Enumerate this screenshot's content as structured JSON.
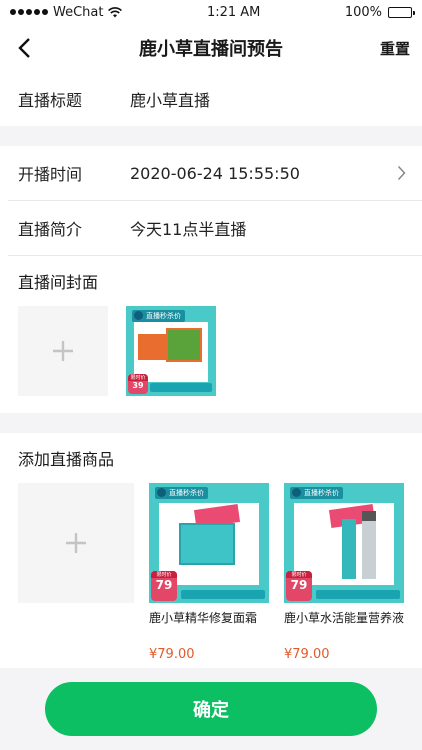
{
  "status_bar": {
    "carrier": "WeChat",
    "time": "1:21 AM",
    "battery": "100%"
  },
  "header": {
    "title": "鹿小草直播间预告",
    "reset_label": "重置"
  },
  "form": {
    "live_title": {
      "label": "直播标题",
      "value": "鹿小草直播"
    },
    "start_time": {
      "label": "开播时间",
      "value": "2020-06-24 15:55:50"
    },
    "intro": {
      "label": "直播简介",
      "value": "今天11点半直播"
    }
  },
  "cover": {
    "title": "直播间封面",
    "image": {
      "tag": "直播秒杀价",
      "price_caption": "限时价",
      "price": "39"
    }
  },
  "products": {
    "title": "添加直播商品",
    "items": [
      {
        "tag": "直播秒杀价",
        "price_caption": "限时价",
        "badge_price": "79",
        "name": "鹿小草精华修复面霜",
        "price": "¥79.00"
      },
      {
        "tag": "直播秒杀价",
        "price_caption": "限时价",
        "badge_price": "79",
        "name": "鹿小草水活能量营养液",
        "price": "¥79.00"
      }
    ]
  },
  "confirm_label": "确定",
  "colors": {
    "primary": "#0bbf62",
    "price": "#e25a2a",
    "thumb_teal": "#49c9c8",
    "badge_red": "#e24768"
  }
}
